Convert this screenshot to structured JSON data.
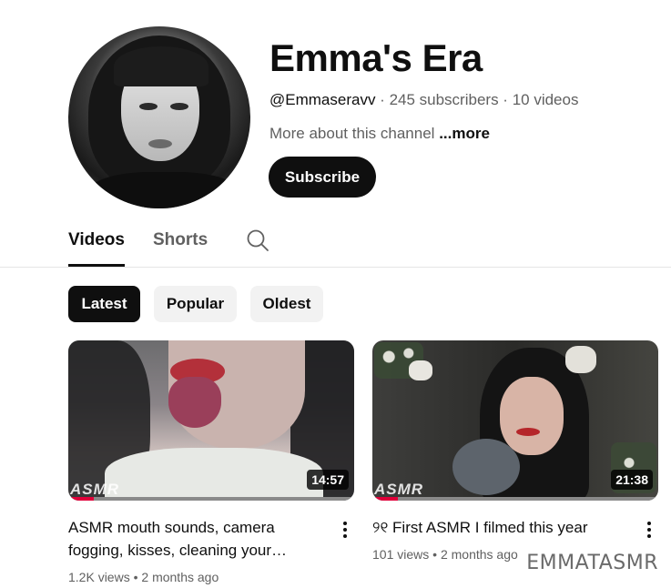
{
  "channel": {
    "name": "Emma's Era",
    "handle": "@Emmaseravv",
    "separator": " · ",
    "subscribers": "245 subscribers",
    "videos_count": "10 videos",
    "about": "More about this channel",
    "about_more": "...more",
    "subscribe_label": "Subscribe"
  },
  "tabs": [
    {
      "label": "Videos",
      "active": true
    },
    {
      "label": "Shorts",
      "active": false
    }
  ],
  "search": {
    "icon": "search-icon"
  },
  "filters": [
    {
      "label": "Latest",
      "active": true
    },
    {
      "label": "Popular",
      "active": false
    },
    {
      "label": "Oldest",
      "active": false
    }
  ],
  "videos": [
    {
      "title": "ASMR mouth sounds, camera fogging, kisses, cleaning your…",
      "views": "1.2K views",
      "age": "2 months ago",
      "duration": "14:57",
      "overlay_text": "ASMR",
      "watched_progress": 0.09
    },
    {
      "title": "୨୧ First ASMR I filmed this year",
      "views": "101 views",
      "age": "2 months ago",
      "duration": "21:38",
      "overlay_text": "ASMR",
      "watched_progress": 0.09
    }
  ],
  "meta_dot": " • ",
  "watermark": "EMMATASMR",
  "colors": {
    "accent": "#0f0f0f",
    "progress": "#e0003a",
    "secondary_text": "#606060"
  }
}
